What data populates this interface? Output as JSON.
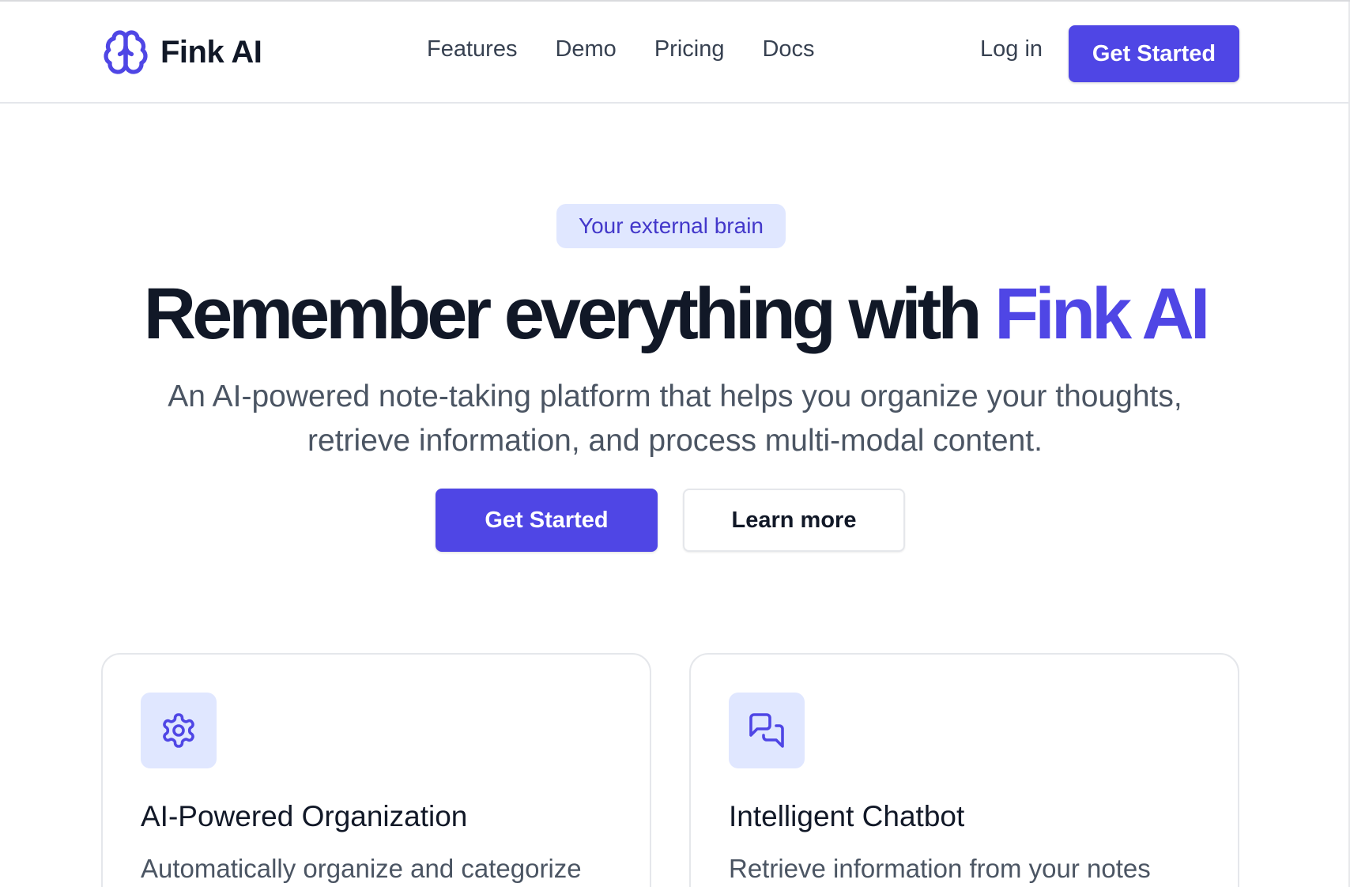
{
  "brand": {
    "name": "Fink AI",
    "icon": "brain-icon",
    "color": "#4f46e5"
  },
  "nav": {
    "items": [
      {
        "label": "Features"
      },
      {
        "label": "Demo"
      },
      {
        "label": "Pricing"
      },
      {
        "label": "Docs"
      }
    ],
    "login_label": "Log in",
    "cta_label": "Get Started"
  },
  "hero": {
    "badge": "Your external brain",
    "headline_main": "Remember everything with ",
    "headline_accent": "Fink AI",
    "subtitle_line1": "An AI-powered note-taking platform that helps you organize your thoughts,",
    "subtitle_line2": "retrieve information, and process multi-modal content.",
    "primary_cta": "Get Started",
    "secondary_cta": "Learn more"
  },
  "features": [
    {
      "icon": "gear-icon",
      "title": "AI-Powered Organization",
      "text": "Automatically organize and categorize"
    },
    {
      "icon": "chat-bubbles-icon",
      "title": "Intelligent Chatbot",
      "text": "Retrieve information from your notes"
    }
  ],
  "colors": {
    "accent": "#4f46e5",
    "accent_light": "#e0e7ff",
    "badge_text": "#4338ca",
    "heading": "#111827",
    "body_text": "#4b5563",
    "border": "#e5e7eb"
  }
}
